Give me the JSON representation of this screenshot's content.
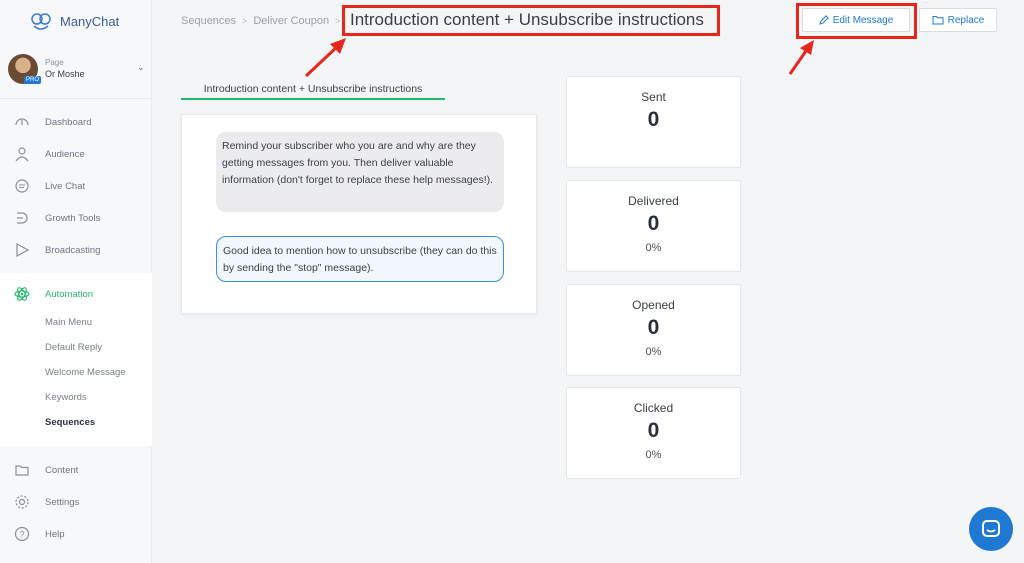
{
  "brand": {
    "name": "ManyChat"
  },
  "page": {
    "label": "Page",
    "name": "Or Moshe",
    "badge": "PRO"
  },
  "nav": {
    "dashboard": "Dashboard",
    "audience": "Audience",
    "live_chat": "Live Chat",
    "growth_tools": "Growth Tools",
    "broadcasting": "Broadcasting",
    "automation": "Automation",
    "content": "Content",
    "settings": "Settings",
    "help": "Help"
  },
  "automation_sub": {
    "main_menu": "Main Menu",
    "default_reply": "Default Reply",
    "welcome_message": "Welcome Message",
    "keywords": "Keywords",
    "sequences": "Sequences"
  },
  "breadcrumb": {
    "item1": "Sequences",
    "item2": "Deliver Coupon",
    "sep": ">"
  },
  "header": {
    "title": "Introduction content + Unsubscribe instructions"
  },
  "toolbar": {
    "edit_label": "Edit Message",
    "replace_label": "Replace"
  },
  "tab": {
    "label": "Introduction content + Unsubscribe instructions"
  },
  "messages": {
    "bubble1": "Remind your subscriber who you are and why are they getting messages from you. Then deliver valuable information (don't forget to replace these help messages!).",
    "bubble2": "Good idea to mention how to unsubscribe (they can do this by sending the \"stop\" message)."
  },
  "stats": {
    "sent": {
      "label": "Sent",
      "value": "0"
    },
    "delivered": {
      "label": "Delivered",
      "value": "0",
      "pct": "0%"
    },
    "opened": {
      "label": "Opened",
      "value": "0",
      "pct": "0%"
    },
    "clicked": {
      "label": "Clicked",
      "value": "0",
      "pct": "0%"
    }
  },
  "colors": {
    "accent_green": "#23b96b",
    "link_blue": "#1f78d1",
    "highlight_red": "#e8261c"
  },
  "icons": {
    "brand": "manychat-logo-icon",
    "dashboard": "speedometer-icon",
    "audience": "person-icon",
    "live_chat": "chat-bubble-icon",
    "growth_tools": "growth-icon",
    "broadcasting": "send-icon",
    "automation": "atom-icon",
    "content": "folder-icon",
    "settings": "gear-icon",
    "help": "question-icon",
    "edit": "pen-icon",
    "replace": "folder-icon",
    "chat_widget": "chat-widget-icon"
  }
}
